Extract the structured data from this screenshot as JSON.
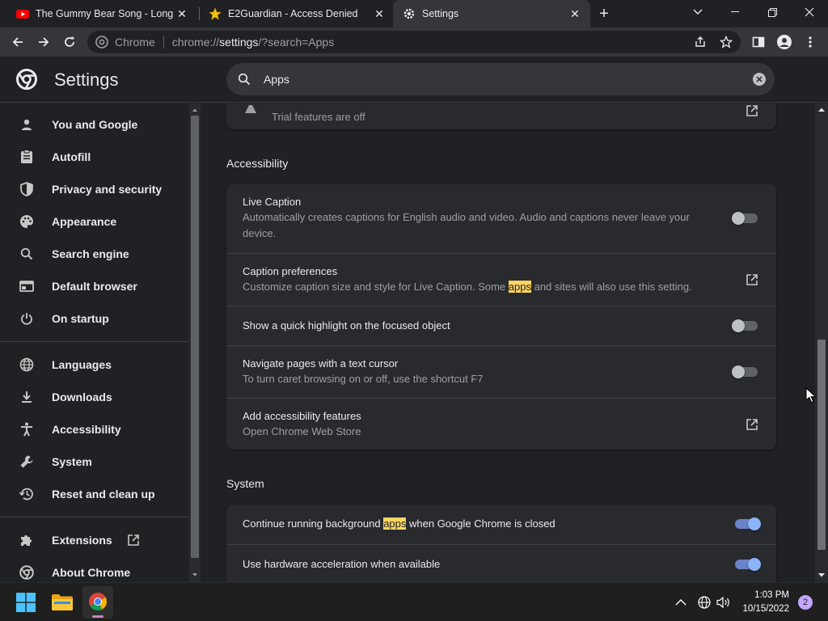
{
  "tabs": [
    {
      "title": "The Gummy Bear Song - Long English Version"
    },
    {
      "title": "E2Guardian - Access Denied"
    },
    {
      "title": "Settings"
    }
  ],
  "omnibox": {
    "origin": "Chrome",
    "scheme": "chrome://",
    "host": "settings",
    "path": "/?search=Apps"
  },
  "settings": {
    "title": "Settings",
    "search_value": "Apps"
  },
  "sidebar": {
    "items": [
      {
        "label": "You and Google",
        "icon": "person-icon"
      },
      {
        "label": "Autofill",
        "icon": "clipboard-icon"
      },
      {
        "label": "Privacy and security",
        "icon": "shield-icon"
      },
      {
        "label": "Appearance",
        "icon": "palette-icon"
      },
      {
        "label": "Search engine",
        "icon": "search-icon"
      },
      {
        "label": "Default browser",
        "icon": "browser-icon"
      },
      {
        "label": "On startup",
        "icon": "power-icon"
      },
      {
        "label": "Languages",
        "icon": "globe-icon"
      },
      {
        "label": "Downloads",
        "icon": "download-icon"
      },
      {
        "label": "Accessibility",
        "icon": "accessibility-icon"
      },
      {
        "label": "System",
        "icon": "wrench-icon"
      },
      {
        "label": "Reset and clean up",
        "icon": "history-icon"
      },
      {
        "label": "Extensions",
        "icon": "puzzle-icon"
      },
      {
        "label": "About Chrome",
        "icon": "chrome-icon"
      }
    ]
  },
  "main": {
    "trial_sub": "Trial features are off",
    "accessibility": {
      "title": "Accessibility",
      "live_caption": {
        "label": "Live Caption",
        "sub": "Automatically creates captions for English audio and video. Audio and captions never leave your device.",
        "on": false
      },
      "caption_prefs": {
        "label": "Caption preferences",
        "sub_before": "Customize caption size and style for Live Caption. Some ",
        "sub_hl": "apps",
        "sub_after": " and sites will also use this setting."
      },
      "quick_highlight": {
        "label": "Show a quick highlight on the focused object",
        "on": false
      },
      "caret": {
        "label": "Navigate pages with a text cursor",
        "sub": "To turn caret browsing on or off, use the shortcut F7",
        "on": false
      },
      "add_features": {
        "label": "Add accessibility features",
        "sub": "Open Chrome Web Store"
      }
    },
    "system": {
      "title": "System",
      "background": {
        "label_before": "Continue running background ",
        "label_hl": "apps",
        "label_after": " when Google Chrome is closed",
        "on": true
      },
      "hw_accel": {
        "label": "Use hardware acceleration when available",
        "on": true
      }
    }
  },
  "taskbar": {
    "time": "1:03 PM",
    "date": "10/15/2022",
    "notification_count": "2"
  },
  "colors": {
    "accent": "#8ab4f8",
    "highlight": "#fdd663",
    "background": "#202124",
    "card": "#292a2d"
  }
}
